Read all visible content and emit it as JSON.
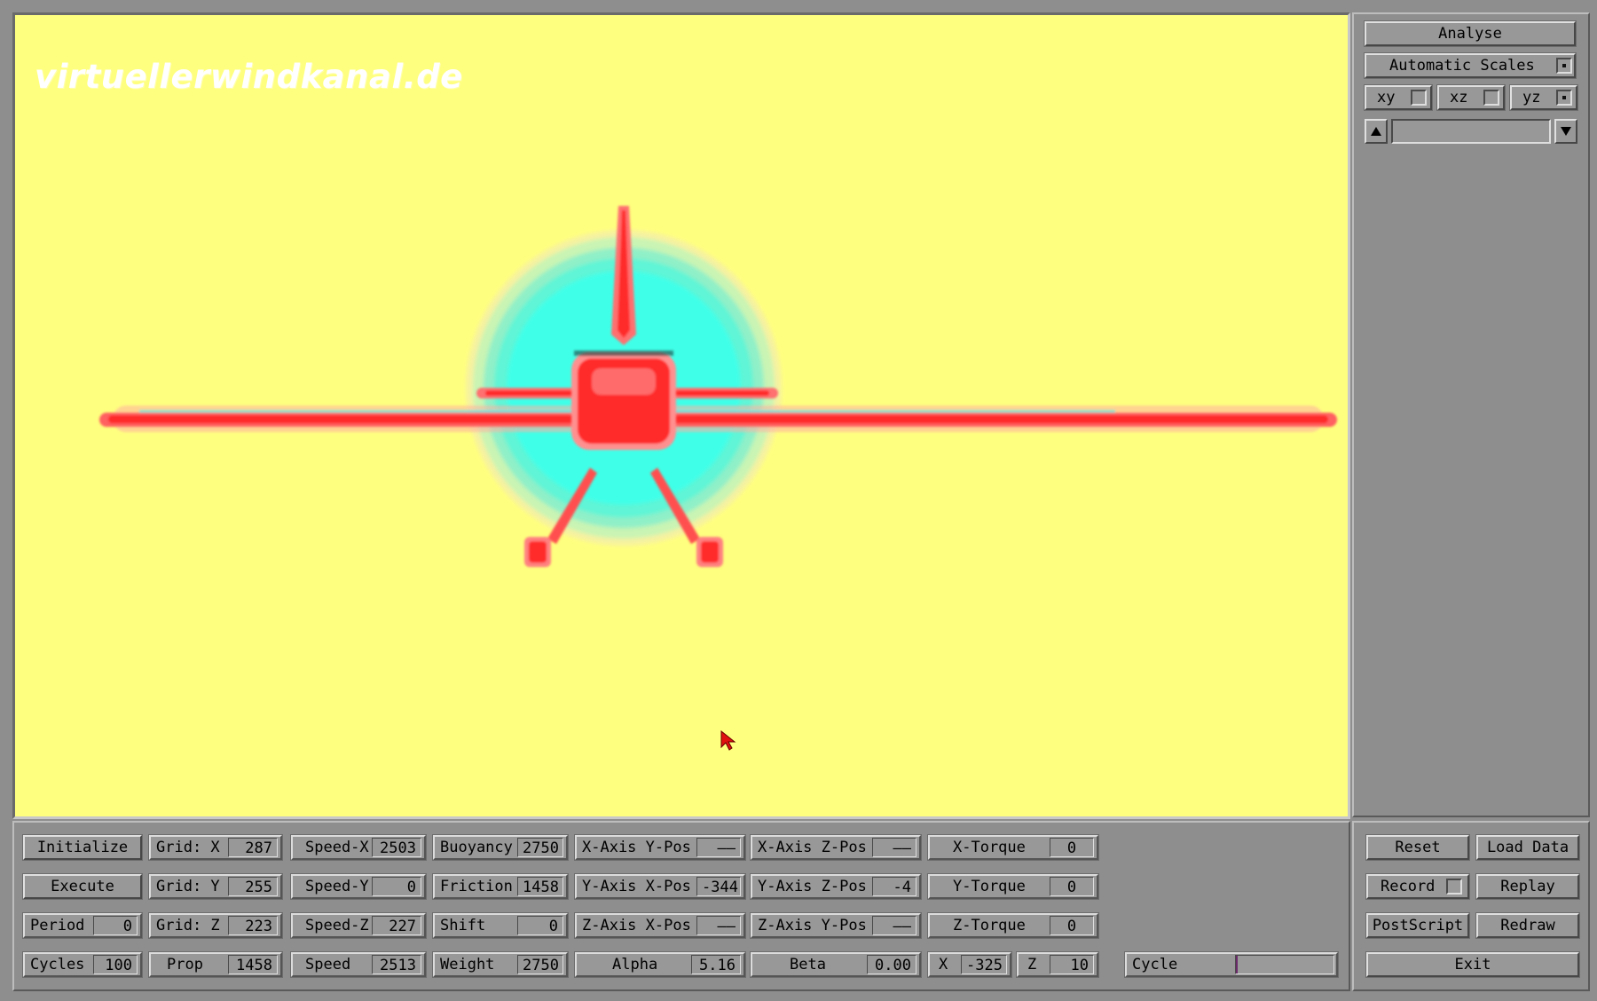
{
  "watermark": "virtuellerwindkanal.de",
  "colors": {
    "background_field": "#ffff7f",
    "pressure_high": "#ff2a2a",
    "pressure_low": "#40ffe8",
    "panel": "#8e8e8e"
  },
  "sidebar": {
    "analyse_label": "Analyse",
    "automatic_scales_label": "Automatic Scales",
    "automatic_scales_checked": true,
    "planes": [
      {
        "label": "xy",
        "checked": false
      },
      {
        "label": "xz",
        "checked": false
      },
      {
        "label": "yz",
        "checked": true
      }
    ],
    "up_icon": "triangle-up-icon",
    "down_icon": "triangle-down-icon"
  },
  "controls": {
    "initialize_label": "Initialize",
    "execute_label": "Execute",
    "period": {
      "label": "Period",
      "value": "0"
    },
    "cycles": {
      "label": "Cycles",
      "value": "100"
    },
    "grid_x": {
      "label": "Grid: X",
      "value": "287"
    },
    "grid_y": {
      "label": "Grid: Y",
      "value": "255"
    },
    "grid_z": {
      "label": "Grid: Z",
      "value": "223"
    },
    "prop": {
      "label": "Prop",
      "value": "1458"
    },
    "speed_x": {
      "label": "Speed-X",
      "value": "2503"
    },
    "speed_y": {
      "label": "Speed-Y",
      "value": "0"
    },
    "speed_z": {
      "label": "Speed-Z",
      "value": "227"
    },
    "speed": {
      "label": "Speed",
      "value": "2513"
    },
    "buoyancy": {
      "label": "Buoyancy",
      "value": "2750"
    },
    "friction": {
      "label": "Friction",
      "value": "1458"
    },
    "shift": {
      "label": "Shift",
      "value": "0"
    },
    "weight": {
      "label": "Weight",
      "value": "2750"
    },
    "x_axis_y_pos": {
      "label": "X-Axis Y-Pos",
      "value": "——"
    },
    "y_axis_x_pos": {
      "label": "Y-Axis X-Pos",
      "value": "-344"
    },
    "z_axis_x_pos": {
      "label": "Z-Axis X-Pos",
      "value": "——"
    },
    "alpha": {
      "label": "Alpha",
      "value": "5.16"
    },
    "x_axis_z_pos": {
      "label": "X-Axis Z-Pos",
      "value": "——"
    },
    "y_axis_z_pos": {
      "label": "Y-Axis Z-Pos",
      "value": "-4"
    },
    "z_axis_y_pos": {
      "label": "Z-Axis Y-Pos",
      "value": "——"
    },
    "beta": {
      "label": "Beta",
      "value": "0.00"
    },
    "x_torque": {
      "label": "X-Torque",
      "value": "0"
    },
    "y_torque": {
      "label": "Y-Torque",
      "value": "0"
    },
    "z_torque": {
      "label": "Z-Torque",
      "value": "0"
    },
    "x": {
      "label": "X",
      "value": "-325"
    },
    "z": {
      "label": "Z",
      "value": "10"
    },
    "cycle": {
      "label": "Cycle",
      "progress": 0.02
    }
  },
  "actions": {
    "reset_label": "Reset",
    "load_data_label": "Load Data",
    "record_label": "Record",
    "record_checked": false,
    "replay_label": "Replay",
    "postscript_label": "PostScript",
    "redraw_label": "Redraw",
    "exit_label": "Exit"
  }
}
